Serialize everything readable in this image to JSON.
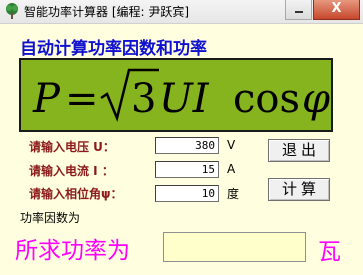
{
  "window": {
    "title": "智能功率计算器 [编程: 尹跃宾]",
    "minimize_glyph": "",
    "close_glyph": "X"
  },
  "main": {
    "heading": "自动计算功率因数和功率",
    "formula": {
      "P": "P",
      "eq": "=",
      "three": "3",
      "UI": "UI",
      "cos": "cos",
      "phi": "φ"
    },
    "inputs": [
      {
        "label": "请输入电压 U：",
        "value": "380",
        "unit": "V"
      },
      {
        "label": "请输入电流 I ：",
        "value": "15",
        "unit": "A"
      },
      {
        "label": "请输入相位角ψ：",
        "value": "10",
        "unit": "度"
      }
    ],
    "buttons": {
      "exit": "退出",
      "calculate": "计算"
    },
    "power_factor_label": "功率因数为",
    "power_label": "所求功率为",
    "power_value": "",
    "power_unit": "瓦"
  },
  "colors": {
    "background": "#ffffe0",
    "heading": "#1010d0",
    "formula_panel": "#86b41e",
    "labels": "#8b1a1a",
    "power_text": "#ff00ff",
    "output_box": "#ffffcc"
  }
}
